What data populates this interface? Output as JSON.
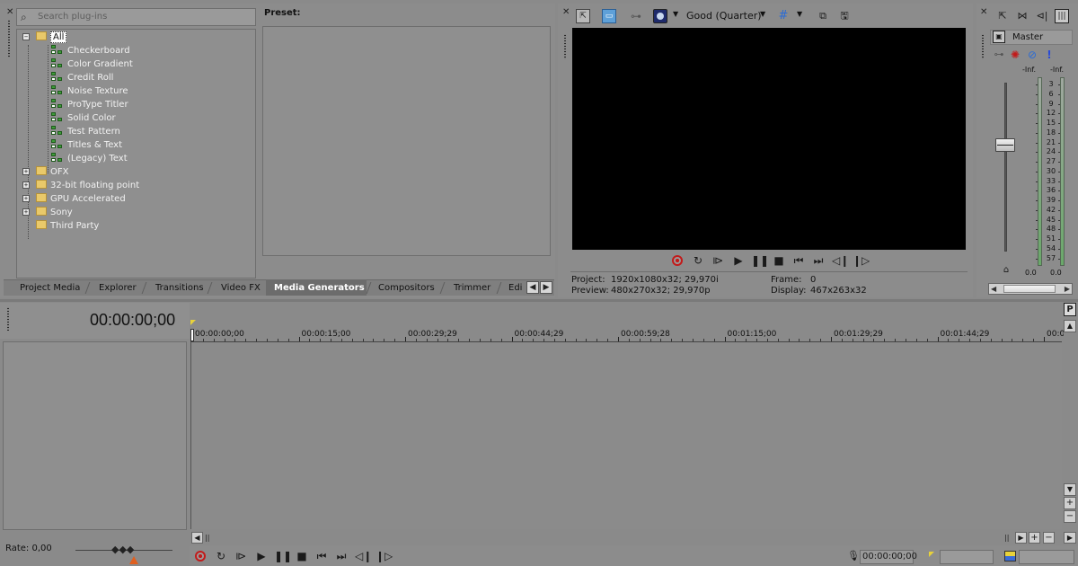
{
  "plugin_browser": {
    "search_placeholder": "Search plug-ins",
    "tree": [
      {
        "label": "All",
        "type": "folder",
        "expanded": true,
        "selected": true
      },
      {
        "label": "Checkerboard",
        "type": "plugin"
      },
      {
        "label": "Color Gradient",
        "type": "plugin"
      },
      {
        "label": "Credit Roll",
        "type": "plugin"
      },
      {
        "label": "Noise Texture",
        "type": "plugin"
      },
      {
        "label": "ProType Titler",
        "type": "plugin"
      },
      {
        "label": "Solid Color",
        "type": "plugin"
      },
      {
        "label": "Test Pattern",
        "type": "plugin"
      },
      {
        "label": "Titles & Text",
        "type": "plugin"
      },
      {
        "label": "(Legacy) Text",
        "type": "plugin"
      },
      {
        "label": "OFX",
        "type": "folder",
        "expander": "+"
      },
      {
        "label": "32-bit floating point",
        "type": "folder",
        "expander": "+"
      },
      {
        "label": "GPU Accelerated",
        "type": "folder",
        "expander": "+"
      },
      {
        "label": "Sony",
        "type": "folder",
        "expander": "+"
      },
      {
        "label": "Third Party",
        "type": "folder"
      }
    ],
    "preset_label": "Preset:"
  },
  "window_tabs": [
    {
      "label": "Project Media",
      "active": false
    },
    {
      "label": "Explorer",
      "active": false
    },
    {
      "label": "Transitions",
      "active": false
    },
    {
      "label": "Video FX",
      "active": false
    },
    {
      "label": "Media Generators",
      "active": true
    },
    {
      "label": "Compositors",
      "active": false
    },
    {
      "label": "Trimmer",
      "active": false
    },
    {
      "label": "Edi",
      "active": false
    }
  ],
  "tab_scroll": {
    "left": "◀",
    "right": "▶"
  },
  "preview": {
    "quality": "Good (Quarter)",
    "project_label": "Project:",
    "project_value": "1920x1080x32; 29,970i",
    "preview_label": "Preview:",
    "preview_value": "480x270x32; 29,970p",
    "frame_label": "Frame:",
    "frame_value": "0",
    "display_label": "Display:",
    "display_value": "467x263x32",
    "screen_color": "#000000"
  },
  "mixer": {
    "master_label": "Master",
    "peak_left": "-Inf.",
    "peak_right": "-Inf.",
    "scale": [
      "3",
      "6",
      "9",
      "12",
      "15",
      "18",
      "21",
      "24",
      "27",
      "30",
      "33",
      "36",
      "39",
      "42",
      "45",
      "48",
      "51",
      "54",
      "57"
    ],
    "level_left": "0.0",
    "level_right": "0.0"
  },
  "timeline": {
    "cursor_time": "00:00:00;00",
    "ruler_ticks": [
      "00:00:00;00",
      "00:00:15;00",
      "00:00:29;29",
      "00:00:44;29",
      "00:00:59;28",
      "00:01:15;00",
      "00:01:29;29",
      "00:01:44;29",
      "00:0"
    ],
    "rate_label": "Rate: 0,00",
    "bottom_time": "00:00:00;00",
    "marker_color": "#e8d23a"
  },
  "colors": {
    "panel_bg": "#8f8f8f",
    "record_red": "#c21a1a",
    "meter_green": "#6aa86a"
  }
}
